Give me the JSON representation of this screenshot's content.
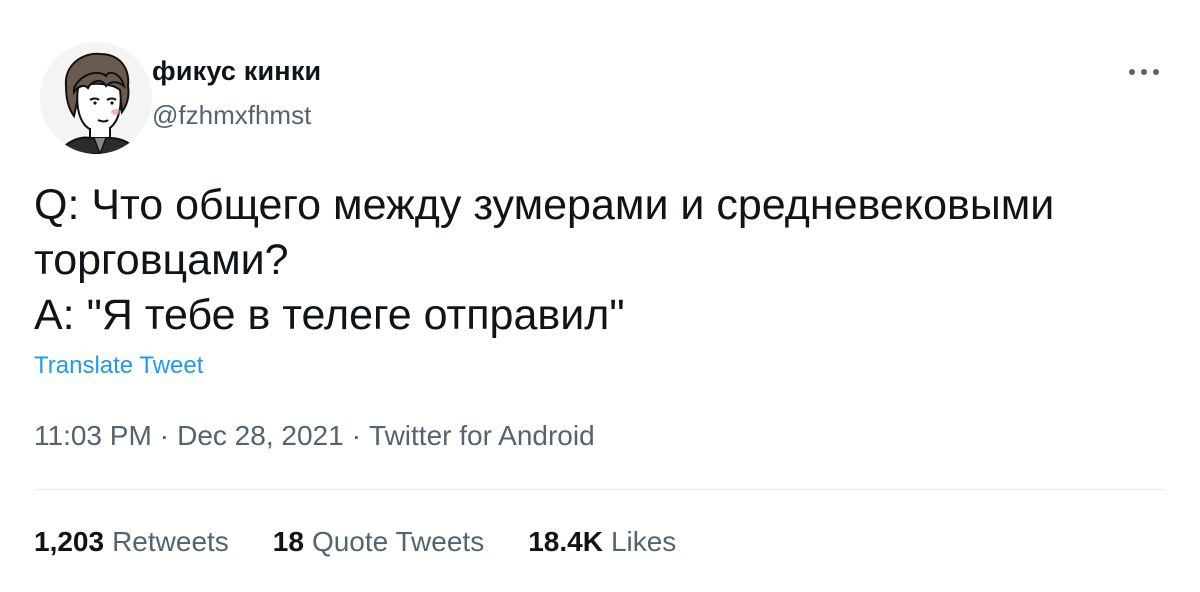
{
  "author": {
    "display_name": "фикус кинки",
    "handle": "@fzhmxfhmst",
    "avatar_icon": "cartoon-avatar-icon"
  },
  "more_icon": "more-dots-icon",
  "tweet": {
    "lines": [
      "Q: Что общего между зумерами и средневековыми",
      "торговцами?",
      "A: \"Я тебе в телеге отправил\""
    ],
    "translate_label": "Translate Tweet"
  },
  "meta": {
    "time": "11:03 PM",
    "date": "Dec 28, 2021",
    "source": "Twitter for Android",
    "separator": "·"
  },
  "stats": {
    "retweets": {
      "count": "1,203",
      "label": "Retweets"
    },
    "quote_tweets": {
      "count": "18",
      "label": "Quote Tweets"
    },
    "likes": {
      "count": "18.4K",
      "label": "Likes"
    }
  },
  "colors": {
    "text": "#0f1419",
    "secondary": "#536471",
    "link": "#1d9bf0",
    "divider": "#e4e9ec"
  }
}
